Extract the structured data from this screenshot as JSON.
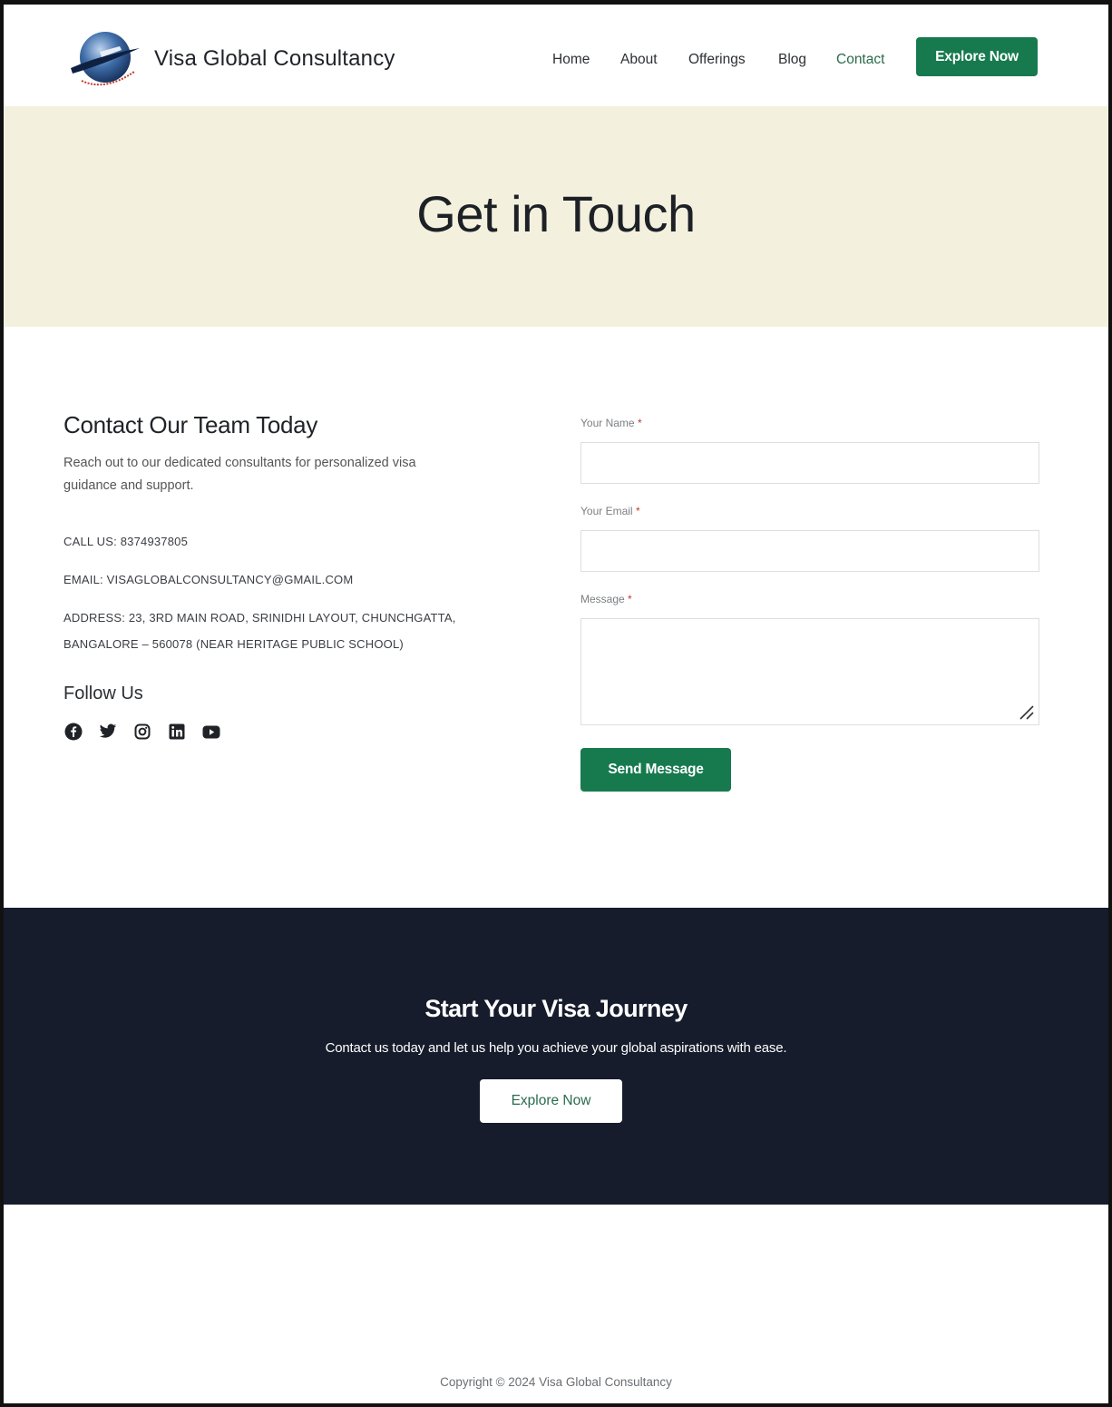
{
  "header": {
    "brand": "Visa Global Consultancy",
    "nav": [
      "Home",
      "About",
      "Offerings",
      "Blog",
      "Contact"
    ],
    "active_nav": "Contact",
    "cta_label": "Explore Now",
    "logo_icon": "globe-airplane-logo"
  },
  "hero": {
    "title": "Get in Touch"
  },
  "contact": {
    "title": "Contact Our Team Today",
    "description": "Reach out to our dedicated consultants for personalized visa guidance and support.",
    "call": "CALL US: 8374937805",
    "email": "EMAIL: VISAGLOBALCONSULTANCY@GMAIL.COM",
    "address_line1": "ADDRESS: 23, 3RD MAIN ROAD, SRINIDHI LAYOUT, CHUNCHGATTA,",
    "address_line2": "BANGALORE – 560078 (NEAR HERITAGE PUBLIC SCHOOL)",
    "follow_title": "Follow Us",
    "socials": [
      "facebook-icon",
      "twitter-icon",
      "instagram-icon",
      "linkedin-icon",
      "youtube-icon"
    ]
  },
  "form": {
    "name_label": "Your Name",
    "email_label": "Your Email",
    "message_label": "Message",
    "required_mark": "*",
    "name_value": "",
    "email_value": "",
    "message_value": "",
    "submit_label": "Send Message"
  },
  "cta": {
    "title": "Start Your Visa Journey",
    "text": "Contact us today and let us help you achieve your global aspirations with ease.",
    "button_label": "Explore Now"
  },
  "footer": {
    "copyright": "Copyright © 2024 Visa Global Consultancy"
  },
  "colors": {
    "accent": "#177a4f",
    "hero_bg": "#f3f1de",
    "cta_bg": "#161c2b"
  }
}
